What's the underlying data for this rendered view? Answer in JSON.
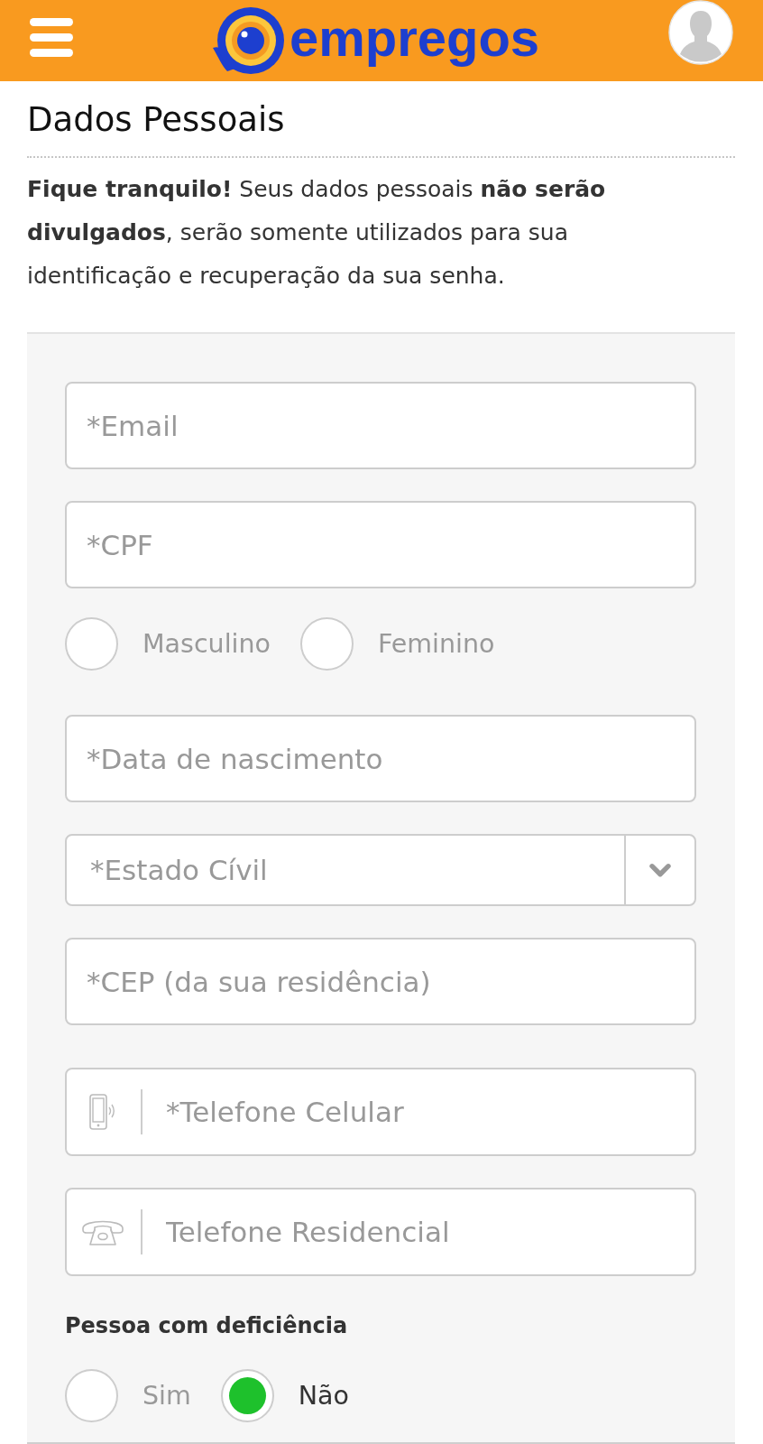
{
  "header": {
    "logo_text": "empregos"
  },
  "section": {
    "title": "Dados Pessoais",
    "notice": "**Fique tranquilo!** Seus dados pessoais **não serão divulgados**, serão somente utilizados para sua identificação e recuperação da sua senha."
  },
  "form": {
    "fields": [
      {
        "kind": "text",
        "placeholder": "*Email"
      },
      {
        "kind": "text",
        "placeholder": "*CPF"
      },
      {
        "kind": "radio_group",
        "options": [
          {
            "label": "Masculino",
            "selected": false
          },
          {
            "label": "Feminino",
            "selected": false
          }
        ]
      },
      {
        "kind": "text",
        "placeholder": "*Data de nascimento"
      },
      {
        "kind": "select",
        "placeholder": "*Estado Cívil"
      },
      {
        "kind": "text",
        "placeholder": "*CEP (da sua residência)"
      },
      {
        "kind": "mobile",
        "placeholder": "*Telefone Celular"
      },
      {
        "kind": "landline",
        "placeholder": "Telefone Residencial"
      },
      {
        "kind": "radio_group",
        "label": "Pessoa com deficiência",
        "options": [
          {
            "label": "Sim",
            "selected": false
          },
          {
            "label": "Não",
            "selected": true
          }
        ]
      }
    ]
  }
}
